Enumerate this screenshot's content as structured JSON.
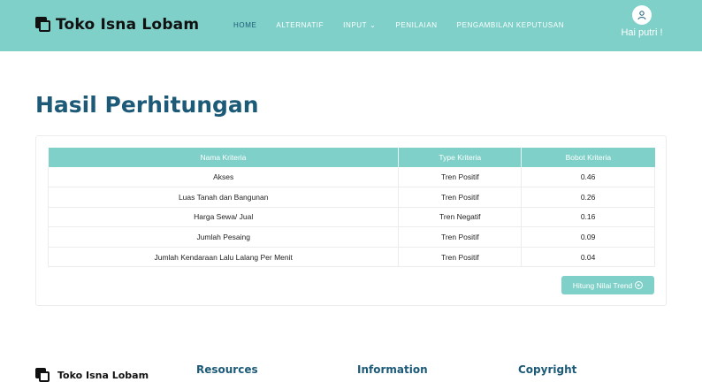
{
  "brand": {
    "name": "Toko Isna Lobam"
  },
  "nav": {
    "items": [
      {
        "label": "HOME"
      },
      {
        "label": "ALTERNATIF"
      },
      {
        "label": "INPUT"
      },
      {
        "label": "PENILAIAN"
      },
      {
        "label": "PENGAMBILAN KEPUTUSAN"
      }
    ],
    "active_item": "HOME"
  },
  "user": {
    "greeting": "Hai putri !",
    "icon": "user-icon"
  },
  "page": {
    "title": "Hasil Perhitungan"
  },
  "table": {
    "headers": [
      "Nama Kriteria",
      "Type Kriteria",
      "Bobot Kriteria"
    ],
    "rows": [
      [
        "Akses",
        "Tren Positif",
        "0.46"
      ],
      [
        "Luas Tanah dan Bangunan",
        "Tren Positif",
        "0.26"
      ],
      [
        "Harga Sewa/ Jual",
        "Tren Negatif",
        "0.16"
      ],
      [
        "Jumlah Pesaing",
        "Tren Positif",
        "0.09"
      ],
      [
        "Jumlah Kendaraan Lalu Lalang Per Menit",
        "Tren Positif",
        "0.04"
      ]
    ]
  },
  "action": {
    "button_label": "Hitung Nilai Trend",
    "icon": "arrow-circle-right-icon"
  },
  "footer": {
    "brand_name": "Toko Isna Lobam",
    "headings": [
      "Resources",
      "Information",
      "Copyright"
    ]
  },
  "colors": {
    "accent": "#7fd0c8",
    "title": "#1c5a78",
    "white": "#ffffff"
  }
}
